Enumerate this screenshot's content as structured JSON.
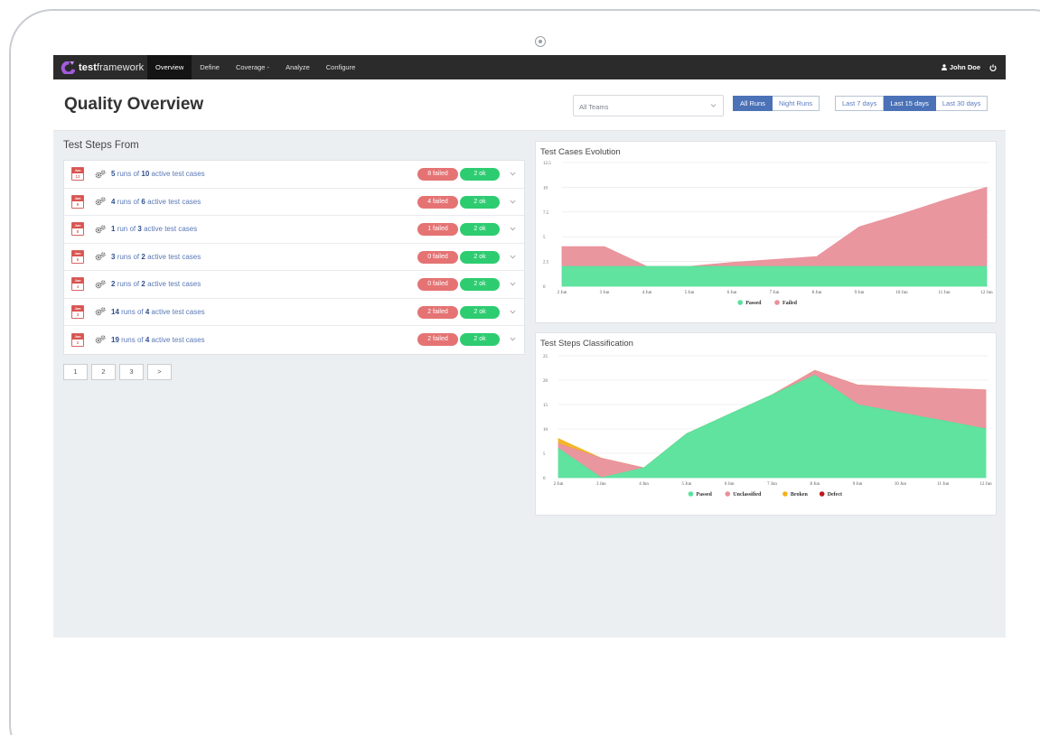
{
  "brand": {
    "bold": "test",
    "rest": "framework"
  },
  "nav": {
    "items": [
      {
        "label": "Overview",
        "active": true
      },
      {
        "label": "Define",
        "active": false
      },
      {
        "label": "Coverage -",
        "active": false
      },
      {
        "label": "Analyze",
        "active": false
      },
      {
        "label": "Configure",
        "active": false
      }
    ],
    "user": "John Doe",
    "icons": {
      "user": "user-icon",
      "power": "power-icon"
    }
  },
  "header": {
    "title": "Quality Overview",
    "team_select": "All Teams",
    "runs": [
      {
        "label": "All Runs",
        "active": true
      },
      {
        "label": "Night Runs",
        "active": false
      }
    ],
    "days": [
      {
        "label": "Last 7 days",
        "active": false
      },
      {
        "label": "Last 15 days",
        "active": true
      },
      {
        "label": "Last 30 days",
        "active": false
      }
    ]
  },
  "steps": {
    "title": "Test Steps From",
    "rows": [
      {
        "month": "Jun",
        "day": "12",
        "runs": "5",
        "runs_word": "runs",
        "cases": "10",
        "failed": "8 failed",
        "ok": "2 ok"
      },
      {
        "month": "Jun",
        "day": "9",
        "runs": "4",
        "runs_word": "runs",
        "cases": "6",
        "failed": "4 failed",
        "ok": "2 ok"
      },
      {
        "month": "Jun",
        "day": "8",
        "runs": "1",
        "runs_word": "run",
        "cases": "3",
        "failed": "1 failed",
        "ok": "2 ok"
      },
      {
        "month": "Jun",
        "day": "5",
        "runs": "3",
        "runs_word": "runs",
        "cases": "2",
        "failed": "0 failed",
        "ok": "2 ok"
      },
      {
        "month": "Jun",
        "day": "4",
        "runs": "2",
        "runs_word": "runs",
        "cases": "2",
        "failed": "0 failed",
        "ok": "2 ok"
      },
      {
        "month": "Jun",
        "day": "3",
        "runs": "14",
        "runs_word": "runs",
        "cases": "4",
        "failed": "2 failed",
        "ok": "2 ok"
      },
      {
        "month": "Jun",
        "day": "2",
        "runs": "19",
        "runs_word": "runs",
        "cases": "4",
        "failed": "2 failed",
        "ok": "2 ok"
      }
    ],
    "of_label": "of",
    "suffix": "active test cases",
    "pages": [
      "1",
      "2",
      "3",
      ">"
    ]
  },
  "colors": {
    "passed": "#58e29b",
    "failed": "#e9909a",
    "broken": "#f2b21b",
    "defect": "#c0151c",
    "accent": "#4b72b7"
  },
  "chart_data": [
    {
      "type": "area",
      "title": "Test Cases Evolution",
      "categories": [
        "2 Jun",
        "3 Jun",
        "4 Jun",
        "5 Jun",
        "6 Jun",
        "7 Jun",
        "8 Jun",
        "9 Jun",
        "10 Jun",
        "11 Jun",
        "12 Jun"
      ],
      "series": [
        {
          "name": "Passed",
          "values": [
            2,
            2,
            2,
            2,
            2,
            2,
            2,
            2,
            2,
            2,
            2
          ]
        },
        {
          "name": "Failed",
          "values": [
            2,
            2,
            0,
            0,
            0.4,
            0.7,
            1,
            4,
            5.3,
            6.7,
            8
          ]
        }
      ],
      "stacked": true,
      "ylim": [
        0,
        12.5
      ],
      "yticks": [
        "0",
        "2.5",
        "5",
        "7.5",
        "10",
        "12.5"
      ],
      "legend": "bottom",
      "grid": true
    },
    {
      "type": "area",
      "title": "Test Steps Classification",
      "categories": [
        "2 Jun",
        "3 Jun",
        "4 Jun",
        "5 Jun",
        "6 Jun",
        "7 Jun",
        "8 Jun",
        "9 Jun",
        "10 Jun",
        "11 Jun",
        "12 Jun"
      ],
      "series": [
        {
          "name": "Passed",
          "values": [
            6,
            0,
            2,
            9,
            13,
            17,
            21,
            15,
            13.3,
            11.7,
            10
          ]
        },
        {
          "name": "Unclassified",
          "values": [
            1,
            4,
            0,
            0,
            0,
            0,
            1,
            4,
            5.3,
            6.6,
            8
          ]
        },
        {
          "name": "Broken",
          "values": [
            1,
            0,
            0,
            0,
            0,
            0,
            0,
            0,
            0,
            0,
            0
          ]
        },
        {
          "name": "Defect",
          "values": [
            0,
            0,
            0,
            0,
            0,
            0,
            0,
            0,
            0,
            0,
            0
          ]
        }
      ],
      "stacked": true,
      "ylim": [
        0,
        25
      ],
      "yticks": [
        "0",
        "5",
        "10",
        "15",
        "20",
        "25"
      ],
      "legend": "bottom",
      "grid": true
    }
  ]
}
